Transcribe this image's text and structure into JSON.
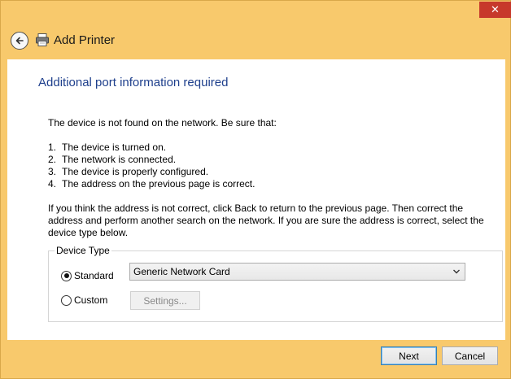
{
  "window": {
    "title": "Add Printer",
    "close_label": "✕"
  },
  "icons": {
    "back": "back-arrow-icon",
    "printer": "printer-icon",
    "close": "close-icon",
    "dropdown": "chevron-down-icon"
  },
  "colors": {
    "title_bar": "#f8c96c",
    "heading": "#1e3f8c",
    "close_button": "#c7392b"
  },
  "main": {
    "heading": "Additional port information required",
    "intro": "The device is not found on the network.  Be sure that:",
    "checklist": [
      {
        "num": "1.",
        "text": "The device is turned on."
      },
      {
        "num": "2.",
        "text": "The network is connected."
      },
      {
        "num": "3.",
        "text": "The device is properly configured."
      },
      {
        "num": "4.",
        "text": "The address on the previous page is correct."
      }
    ],
    "instructions": "If you think the address is not correct, click Back to return to the previous page.  Then correct the address and perform another search on the network.  If you are sure the address is correct, select the device type below."
  },
  "device_type": {
    "group_label": "Device Type",
    "standard_label": "Standard",
    "custom_label": "Custom",
    "selected": "standard",
    "standard_value": "Generic Network Card",
    "settings_label": "Settings..."
  },
  "footer": {
    "next_label": "Next",
    "cancel_label": "Cancel"
  }
}
